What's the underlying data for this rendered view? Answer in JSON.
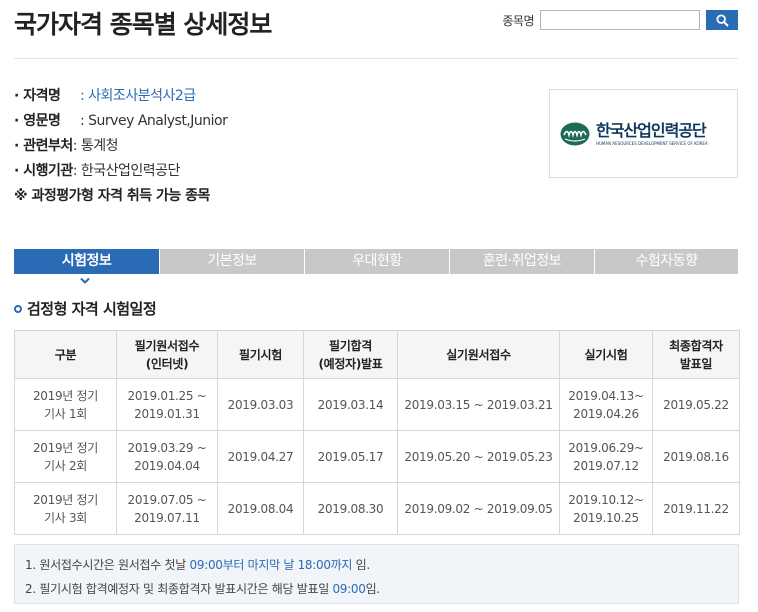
{
  "header": {
    "title": "국가자격 종목별 상세정보",
    "search_label": "종목명",
    "search_value": "",
    "search_placeholder": ""
  },
  "info": {
    "rows": [
      {
        "label": "· 자격명",
        "value": ": 사회조사분석사2급"
      },
      {
        "label": "· 영문명",
        "value": ": Survey Analyst,Junior"
      },
      {
        "label": "· 관련부처",
        "value": ": 통계청"
      },
      {
        "label": "· 시행기관",
        "value": ": 한국산업인력공단"
      }
    ],
    "note": "※ 과정평가형 자격 취득 가능 종목"
  },
  "logo": {
    "name": "한국산업인력공단",
    "sub": "HUMAN RESOURCES DEVELOPMENT SERVICE OF KOREA"
  },
  "tabs": [
    {
      "label": "시험정보",
      "active": true
    },
    {
      "label": "기본정보",
      "active": false
    },
    {
      "label": "우대현황",
      "active": false
    },
    {
      "label": "훈련·취업정보",
      "active": false
    },
    {
      "label": "수험자동향",
      "active": false
    }
  ],
  "section_title": "검정형 자격 시험일정",
  "schedule": {
    "headers": [
      [
        "구분"
      ],
      [
        "필기원서접수",
        "(인터넷)"
      ],
      [
        "필기시험"
      ],
      [
        "필기합격",
        "(예정자)발표"
      ],
      [
        "실기원서접수"
      ],
      [
        "실기시험"
      ],
      [
        "최종합격자",
        "발표일"
      ]
    ],
    "rows": [
      [
        [
          "2019년 정기",
          "기사 1회"
        ],
        [
          "2019.01.25 ~",
          "2019.01.31"
        ],
        [
          "2019.03.03"
        ],
        [
          "2019.03.14"
        ],
        [
          "2019.03.15 ~ 2019.03.21"
        ],
        [
          "2019.04.13~",
          "2019.04.26"
        ],
        [
          "2019.05.22"
        ]
      ],
      [
        [
          "2019년 정기",
          "기사 2회"
        ],
        [
          "2019.03.29 ~",
          "2019.04.04"
        ],
        [
          "2019.04.27"
        ],
        [
          "2019.05.17"
        ],
        [
          "2019.05.20 ~ 2019.05.23"
        ],
        [
          "2019.06.29~",
          "2019.07.12"
        ],
        [
          "2019.08.16"
        ]
      ],
      [
        [
          "2019년 정기",
          "기사 3회"
        ],
        [
          "2019.07.05 ~",
          "2019.07.11"
        ],
        [
          "2019.08.04"
        ],
        [
          "2019.08.30"
        ],
        [
          "2019.09.02 ~ 2019.09.05"
        ],
        [
          "2019.10.12~",
          "2019.10.25"
        ],
        [
          "2019.11.22"
        ]
      ]
    ]
  },
  "notes": [
    {
      "pre": "1. 원서접수시간은 원서접수 첫날 ",
      "hl": "09:00부터 마지막 날 18:00까지",
      "post": " 임."
    },
    {
      "pre": "2. 필기시험 합격예정자 및 최종합격자 발표시간은 해당 발표일 ",
      "hl": "09:00",
      "post": "임."
    }
  ],
  "colors": {
    "accent": "#2a6bb5",
    "tab_inactive": "#c8c8c8",
    "notes_bg": "#f1f4f8"
  }
}
